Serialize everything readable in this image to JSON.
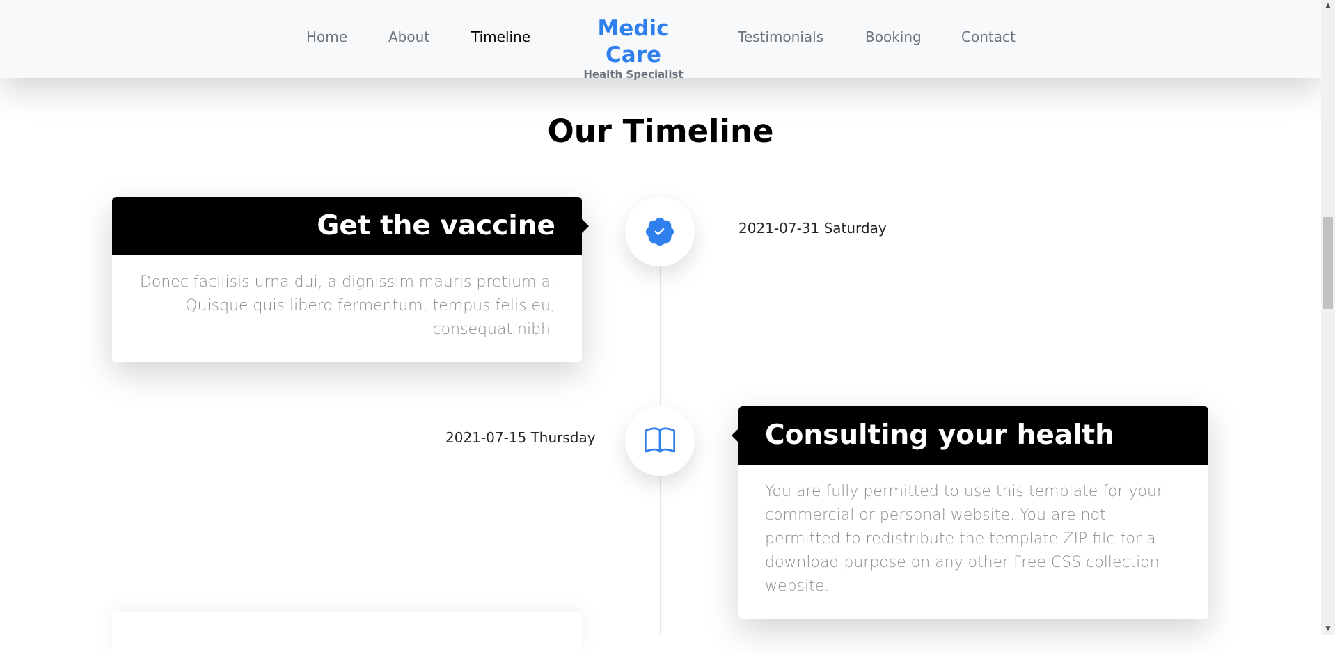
{
  "nav": {
    "links": [
      {
        "label": "Home"
      },
      {
        "label": "About"
      },
      {
        "label": "Timeline",
        "active": true
      },
      {
        "label": "Testimonials"
      },
      {
        "label": "Booking"
      },
      {
        "label": "Contact"
      }
    ],
    "brand": {
      "title": "Medic Care",
      "subtitle": "Health Specialist"
    }
  },
  "section": {
    "title": "Our Timeline"
  },
  "timeline": [
    {
      "title": "Get the vaccine",
      "text": "Donec facilisis urna dui, a dignissim mauris pretium a. Quisque quis libero fermentum, tempus felis eu, consequat nibh.",
      "date": "2021-07-31 Saturday",
      "icon": "patch-check-icon"
    },
    {
      "title": "Consulting your health",
      "text": "You are fully permitted to use this template for your commercial or personal website. You are not permitted to redistribute the template ZIP file for a download purpose on any other Free CSS collection website.",
      "date": "2021-07-15 Thursday",
      "icon": "book-icon"
    }
  ],
  "colors": {
    "accent": "#2f80ed",
    "card_header": "#000000",
    "body_text": "#8a8f94",
    "nav_bg": "#f8f9fa"
  }
}
